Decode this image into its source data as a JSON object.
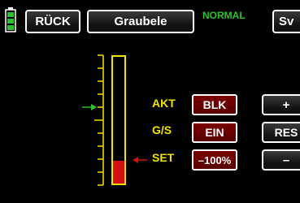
{
  "colors": {
    "background": "#000000",
    "accent_yellow": "#f2e200",
    "mode_green": "#2cc22c",
    "set_red": "#d40f0f",
    "button_red": "#6a0000",
    "battery_green": "#2cc22c"
  },
  "header": {
    "back_label": "RÜCK",
    "model_label": "Graubele",
    "mode_label": "NORMAL",
    "right_label": "Sv"
  },
  "rows": {
    "akt_label": "AKT",
    "gs_label": "G/S",
    "set_label": "SET",
    "akt_value": "BLK",
    "gs_value": "EIN",
    "set_value": "–100%"
  },
  "controls": {
    "plus_label": "+",
    "reset_label": "RES",
    "minus_label": "–"
  },
  "gauge": {
    "set_level": 0.18,
    "akt_level": 0.57,
    "icons": {
      "akt_marker": "arrow-right-icon",
      "set_marker": "arrow-left-icon",
      "battery": "battery-icon"
    }
  }
}
